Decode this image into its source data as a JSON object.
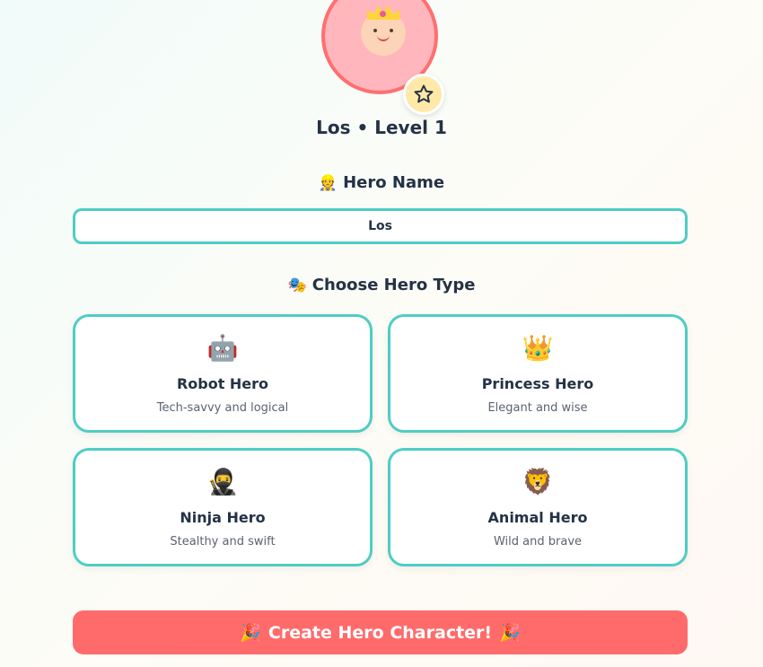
{
  "profile": {
    "name": "Los",
    "level_line": "Los • Level 1",
    "avatar_icon": "princess-avatar",
    "badge_icon": "star-icon"
  },
  "name_section": {
    "icon": "👷",
    "title": "Hero Name",
    "value": "Los"
  },
  "type_section": {
    "icon": "🎭",
    "title": "Choose Hero Type",
    "options": [
      {
        "icon": "🤖",
        "title": "Robot Hero",
        "desc": "Tech-savvy and logical"
      },
      {
        "icon": "👑",
        "title": "Princess Hero",
        "desc": "Elegant and wise"
      },
      {
        "icon": "🥷",
        "title": "Ninja Hero",
        "desc": "Stealthy and swift"
      },
      {
        "icon": "🦁",
        "title": "Animal Hero",
        "desc": "Wild and brave"
      }
    ]
  },
  "create_button": {
    "icon_left": "🎉",
    "label": "Create Hero Character!",
    "icon_right": "🎉"
  },
  "colors": {
    "accent": "#4ecdc4",
    "primary": "#ff6b6b",
    "text": "#243246"
  }
}
